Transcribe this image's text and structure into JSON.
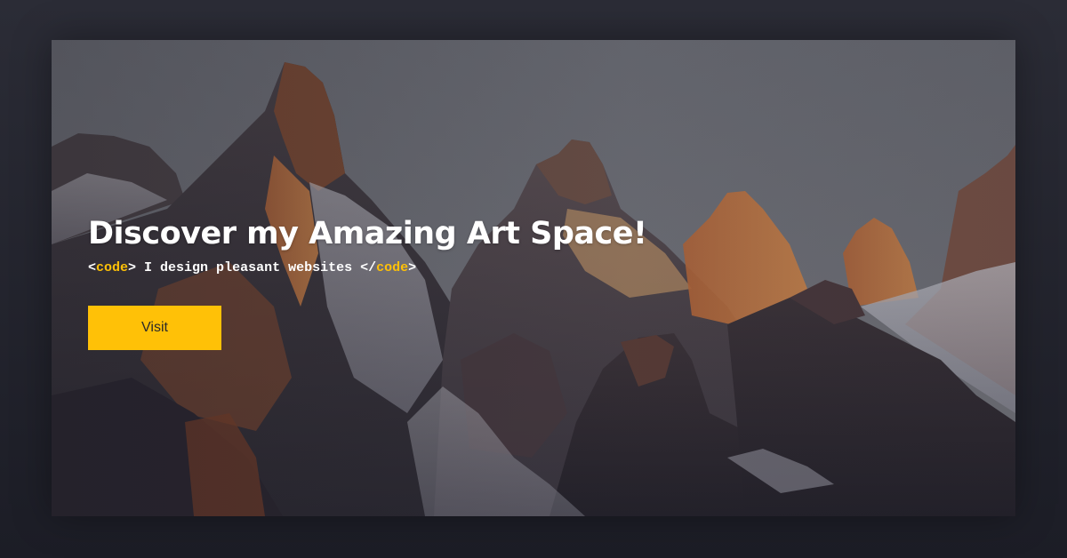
{
  "hero": {
    "title": "Discover my Amazing Art Space!",
    "subtitle": {
      "open_bracket": "<",
      "open_tag": "code",
      "open_close_bracket": ">",
      "text": " I design pleasant websites ",
      "close_bracket": "</",
      "close_tag": "code",
      "close_close_bracket": ">"
    },
    "button_label": "Visit",
    "background_image": "mountain-landscape"
  },
  "colors": {
    "page_background": "#24252f",
    "accent": "#ffc107",
    "title_text": "#ffffff"
  }
}
